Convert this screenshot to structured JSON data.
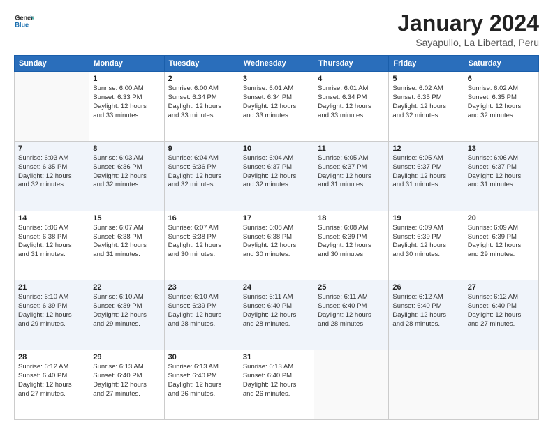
{
  "header": {
    "logo": {
      "line1": "General",
      "line2": "Blue"
    },
    "title": "January 2024",
    "subtitle": "Sayapullo, La Libertad, Peru"
  },
  "weekdays": [
    "Sunday",
    "Monday",
    "Tuesday",
    "Wednesday",
    "Thursday",
    "Friday",
    "Saturday"
  ],
  "weeks": [
    [
      {
        "day": "",
        "info": ""
      },
      {
        "day": "1",
        "info": "Sunrise: 6:00 AM\nSunset: 6:33 PM\nDaylight: 12 hours\nand 33 minutes."
      },
      {
        "day": "2",
        "info": "Sunrise: 6:00 AM\nSunset: 6:34 PM\nDaylight: 12 hours\nand 33 minutes."
      },
      {
        "day": "3",
        "info": "Sunrise: 6:01 AM\nSunset: 6:34 PM\nDaylight: 12 hours\nand 33 minutes."
      },
      {
        "day": "4",
        "info": "Sunrise: 6:01 AM\nSunset: 6:34 PM\nDaylight: 12 hours\nand 33 minutes."
      },
      {
        "day": "5",
        "info": "Sunrise: 6:02 AM\nSunset: 6:35 PM\nDaylight: 12 hours\nand 32 minutes."
      },
      {
        "day": "6",
        "info": "Sunrise: 6:02 AM\nSunset: 6:35 PM\nDaylight: 12 hours\nand 32 minutes."
      }
    ],
    [
      {
        "day": "7",
        "info": "Sunrise: 6:03 AM\nSunset: 6:35 PM\nDaylight: 12 hours\nand 32 minutes."
      },
      {
        "day": "8",
        "info": "Sunrise: 6:03 AM\nSunset: 6:36 PM\nDaylight: 12 hours\nand 32 minutes."
      },
      {
        "day": "9",
        "info": "Sunrise: 6:04 AM\nSunset: 6:36 PM\nDaylight: 12 hours\nand 32 minutes."
      },
      {
        "day": "10",
        "info": "Sunrise: 6:04 AM\nSunset: 6:37 PM\nDaylight: 12 hours\nand 32 minutes."
      },
      {
        "day": "11",
        "info": "Sunrise: 6:05 AM\nSunset: 6:37 PM\nDaylight: 12 hours\nand 31 minutes."
      },
      {
        "day": "12",
        "info": "Sunrise: 6:05 AM\nSunset: 6:37 PM\nDaylight: 12 hours\nand 31 minutes."
      },
      {
        "day": "13",
        "info": "Sunrise: 6:06 AM\nSunset: 6:37 PM\nDaylight: 12 hours\nand 31 minutes."
      }
    ],
    [
      {
        "day": "14",
        "info": "Sunrise: 6:06 AM\nSunset: 6:38 PM\nDaylight: 12 hours\nand 31 minutes."
      },
      {
        "day": "15",
        "info": "Sunrise: 6:07 AM\nSunset: 6:38 PM\nDaylight: 12 hours\nand 31 minutes."
      },
      {
        "day": "16",
        "info": "Sunrise: 6:07 AM\nSunset: 6:38 PM\nDaylight: 12 hours\nand 30 minutes."
      },
      {
        "day": "17",
        "info": "Sunrise: 6:08 AM\nSunset: 6:38 PM\nDaylight: 12 hours\nand 30 minutes."
      },
      {
        "day": "18",
        "info": "Sunrise: 6:08 AM\nSunset: 6:39 PM\nDaylight: 12 hours\nand 30 minutes."
      },
      {
        "day": "19",
        "info": "Sunrise: 6:09 AM\nSunset: 6:39 PM\nDaylight: 12 hours\nand 30 minutes."
      },
      {
        "day": "20",
        "info": "Sunrise: 6:09 AM\nSunset: 6:39 PM\nDaylight: 12 hours\nand 29 minutes."
      }
    ],
    [
      {
        "day": "21",
        "info": "Sunrise: 6:10 AM\nSunset: 6:39 PM\nDaylight: 12 hours\nand 29 minutes."
      },
      {
        "day": "22",
        "info": "Sunrise: 6:10 AM\nSunset: 6:39 PM\nDaylight: 12 hours\nand 29 minutes."
      },
      {
        "day": "23",
        "info": "Sunrise: 6:10 AM\nSunset: 6:39 PM\nDaylight: 12 hours\nand 28 minutes."
      },
      {
        "day": "24",
        "info": "Sunrise: 6:11 AM\nSunset: 6:40 PM\nDaylight: 12 hours\nand 28 minutes."
      },
      {
        "day": "25",
        "info": "Sunrise: 6:11 AM\nSunset: 6:40 PM\nDaylight: 12 hours\nand 28 minutes."
      },
      {
        "day": "26",
        "info": "Sunrise: 6:12 AM\nSunset: 6:40 PM\nDaylight: 12 hours\nand 28 minutes."
      },
      {
        "day": "27",
        "info": "Sunrise: 6:12 AM\nSunset: 6:40 PM\nDaylight: 12 hours\nand 27 minutes."
      }
    ],
    [
      {
        "day": "28",
        "info": "Sunrise: 6:12 AM\nSunset: 6:40 PM\nDaylight: 12 hours\nand 27 minutes."
      },
      {
        "day": "29",
        "info": "Sunrise: 6:13 AM\nSunset: 6:40 PM\nDaylight: 12 hours\nand 27 minutes."
      },
      {
        "day": "30",
        "info": "Sunrise: 6:13 AM\nSunset: 6:40 PM\nDaylight: 12 hours\nand 26 minutes."
      },
      {
        "day": "31",
        "info": "Sunrise: 6:13 AM\nSunset: 6:40 PM\nDaylight: 12 hours\nand 26 minutes."
      },
      {
        "day": "",
        "info": ""
      },
      {
        "day": "",
        "info": ""
      },
      {
        "day": "",
        "info": ""
      }
    ]
  ]
}
